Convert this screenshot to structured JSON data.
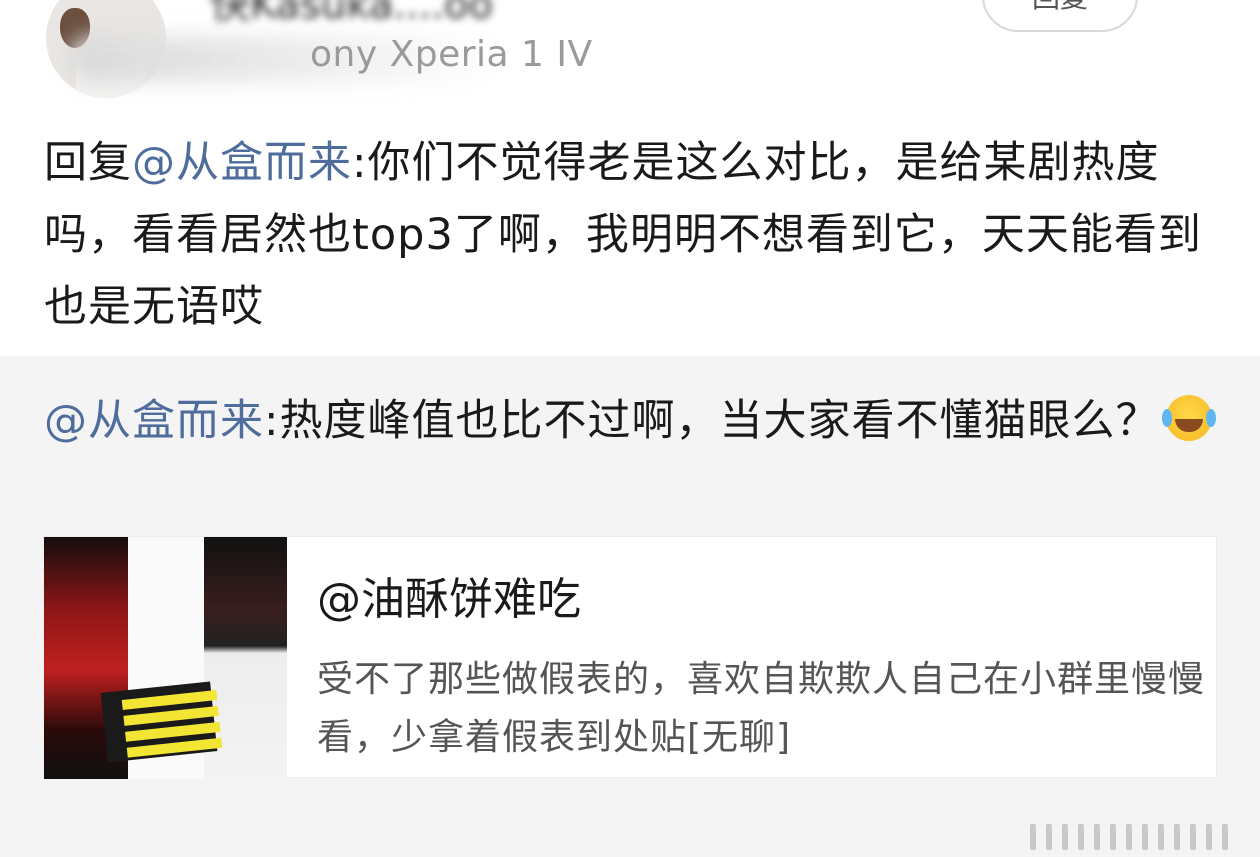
{
  "header": {
    "username": "快Kasuka....oo",
    "meta": "ony Xperia 1 IV",
    "reply_button": "回复"
  },
  "comment": {
    "prefix": "回复",
    "mention": "@从盒而来",
    "text": ":你们不觉得老是这么对比，是给某剧热度吗，看看居然也top3了啊，我明明不想看到它，天天能看到也是无语哎"
  },
  "quoted": {
    "mention": "@从盒而来",
    "text": ":热度峰值也比不过啊，当大家看不懂猫眼么？",
    "emoji": "laughing-crying-emoji"
  },
  "card": {
    "title": "@油酥饼难吃",
    "text": "受不了那些做假表的，喜欢自欺欺人自己在小群里慢慢看，少拿着假表到处贴[无聊]"
  },
  "colors": {
    "mention": "#4e6c9c",
    "quote_bg": "#f4f4f4",
    "text": "#1a1a1a",
    "card_text": "#555555"
  }
}
